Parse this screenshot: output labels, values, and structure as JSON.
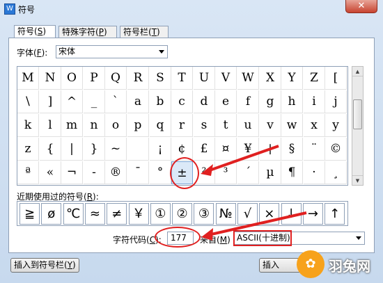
{
  "window": {
    "title": "符号",
    "close_glyph": "✕"
  },
  "tabs": [
    {
      "label": "符号",
      "key": "S",
      "active": true
    },
    {
      "label": "特殊字符",
      "key": "P",
      "active": false
    },
    {
      "label": "符号栏",
      "key": "T",
      "active": false
    }
  ],
  "font": {
    "label": "字体",
    "key": "F",
    "value": "宋体"
  },
  "symbol_grid": {
    "rows": [
      [
        "M",
        "N",
        "O",
        "P",
        "Q",
        "R",
        "S",
        "T",
        "U",
        "V",
        "W",
        "X",
        "Y",
        "Z",
        "["
      ],
      [
        "\\",
        "]",
        "^",
        "_",
        "`",
        "a",
        "b",
        "c",
        "d",
        "e",
        "f",
        "g",
        "h",
        "i",
        "j"
      ],
      [
        "k",
        "l",
        "m",
        "n",
        "o",
        "p",
        "q",
        "r",
        "s",
        "t",
        "u",
        "v",
        "w",
        "x",
        "y"
      ],
      [
        "z",
        "{",
        "|",
        "}",
        "~",
        " ",
        "¡",
        "¢",
        "£",
        "¤",
        "¥",
        "¦",
        "§",
        "¨",
        "©"
      ],
      [
        "ª",
        "«",
        "¬",
        "-",
        "®",
        "¯",
        "°",
        "±",
        "²",
        "³",
        "´",
        "µ",
        "¶",
        "·",
        "¸"
      ]
    ],
    "selected_symbol": "±"
  },
  "recent": {
    "label": "近期使用过的符号",
    "key": "R",
    "symbols": [
      "≧",
      "ø",
      "℃",
      "≈",
      "≠",
      "￥",
      "①",
      "②",
      "③",
      "№",
      "√",
      "×",
      "↓",
      "→",
      "↑"
    ]
  },
  "char_code": {
    "label": "字符代码",
    "key": "C",
    "value": "177"
  },
  "from": {
    "label": "来自",
    "key": "M",
    "value": "ASCII(十进制)"
  },
  "buttons": {
    "insert_to_bar": "插入到符号栏",
    "insert_to_bar_key": "Y",
    "insert": "插入"
  },
  "watermark": {
    "text": "羽兔网"
  },
  "colors": {
    "annotation_red": "#e02020",
    "selection_bg": "#dbe9f8"
  }
}
